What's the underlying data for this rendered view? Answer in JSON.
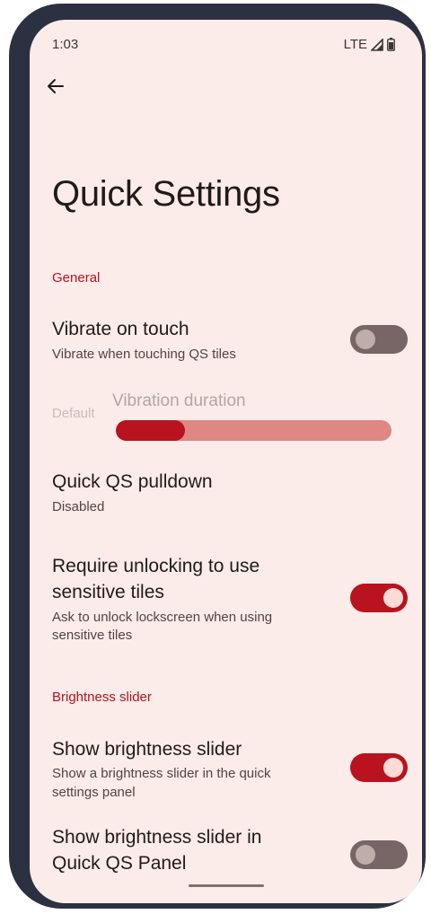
{
  "status_bar": {
    "time": "1:03",
    "network": "LTE"
  },
  "header": {
    "back_icon": "arrow-back-icon",
    "title": "Quick Settings"
  },
  "sections": {
    "general": {
      "header": "General",
      "vibrate": {
        "title": "Vibrate on touch",
        "summary": "Vibrate when touching QS tiles",
        "enabled": false
      },
      "vibration_duration": {
        "default_label": "Default",
        "title": "Vibration duration",
        "value_fraction": 0.25
      },
      "pulldown": {
        "title": "Quick QS pulldown",
        "summary": "Disabled"
      },
      "require_unlock": {
        "title_line1": "Require unlocking to use",
        "title_line2": "sensitive tiles",
        "summary_line1": "Ask to unlock lockscreen when using",
        "summary_line2": "sensitive tiles",
        "enabled": true
      }
    },
    "brightness": {
      "header": "Brightness slider",
      "show_slider": {
        "title": "Show brightness slider",
        "summary_line1": "Show a brightness slider in the quick",
        "summary_line2": "settings panel",
        "enabled": true
      },
      "show_in_quick_qs": {
        "title_line1": "Show brightness slider in",
        "title_line2": "Quick QS Panel",
        "enabled": false
      }
    }
  },
  "colors": {
    "accent": "#b8131e",
    "background": "#fbece9",
    "toggle_off": "#776665"
  }
}
